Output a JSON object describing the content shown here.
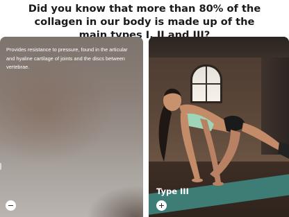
{
  "headline": "Did you know that more than 80% of the collagen in our body is made up of the main types I, II and III?",
  "cards": [
    {
      "description": "Provides resistance to pressure, found in the articular and hyaline cartilage of joints and the discs between vertebrae.",
      "button_icon": "minus-icon"
    },
    {
      "label": "Type III",
      "button_icon": "plus-icon"
    }
  ]
}
